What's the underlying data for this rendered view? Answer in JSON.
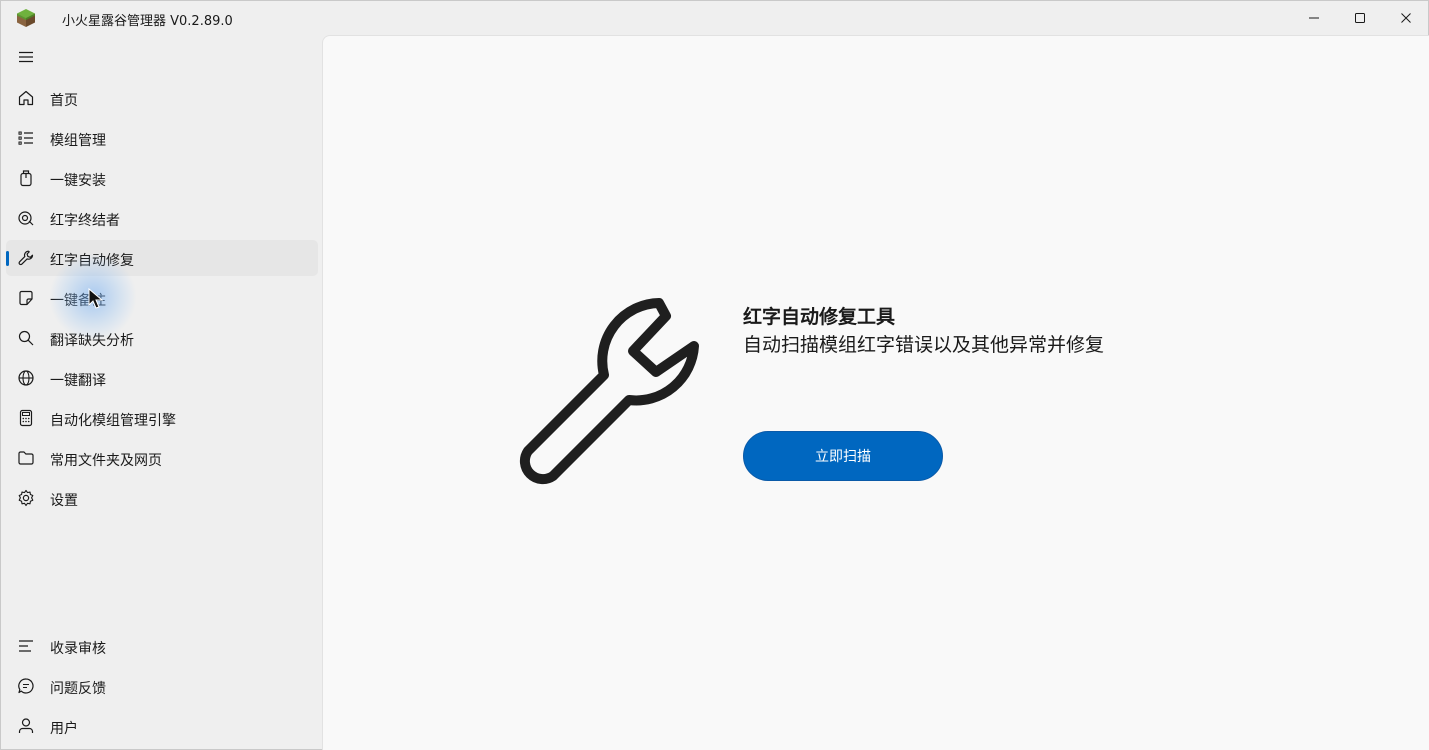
{
  "window": {
    "title": "小火星露谷管理器 V0.2.89.0",
    "app_icon": "grass-block-icon"
  },
  "titlebar_buttons": {
    "minimize": "minimize-icon",
    "maximize": "maximize-icon",
    "close": "close-icon"
  },
  "sidebar": {
    "menu_icon": "hamburger-menu-icon",
    "items": [
      {
        "label": "首页",
        "icon": "home-icon"
      },
      {
        "label": "模组管理",
        "icon": "list-icon"
      },
      {
        "label": "一键安装",
        "icon": "package-icon"
      },
      {
        "label": "红字终结者",
        "icon": "bug-scan-icon"
      },
      {
        "label": "红字自动修复",
        "icon": "wrench-icon",
        "selected": true
      },
      {
        "label": "一键备注",
        "icon": "note-icon"
      },
      {
        "label": "翻译缺失分析",
        "icon": "search-icon"
      },
      {
        "label": "一键翻译",
        "icon": "globe-icon"
      },
      {
        "label": "自动化模组管理引擎",
        "icon": "calculator-icon"
      },
      {
        "label": "常用文件夹及网页",
        "icon": "folder-icon"
      },
      {
        "label": "设置",
        "icon": "gear-icon"
      }
    ],
    "footer_items": [
      {
        "label": "收录审核",
        "icon": "review-list-icon"
      },
      {
        "label": "问题反馈",
        "icon": "feedback-icon"
      },
      {
        "label": "用户",
        "icon": "user-icon"
      }
    ]
  },
  "main": {
    "icon": "wrench-icon",
    "title": "红字自动修复工具",
    "description": "自动扫描模组红字错误以及其他异常并修复",
    "scan_button_label": "立即扫描"
  },
  "colors": {
    "accent": "#0067c0",
    "content_bg": "#f9f9f9",
    "sidebar_bg": "#efefef"
  }
}
